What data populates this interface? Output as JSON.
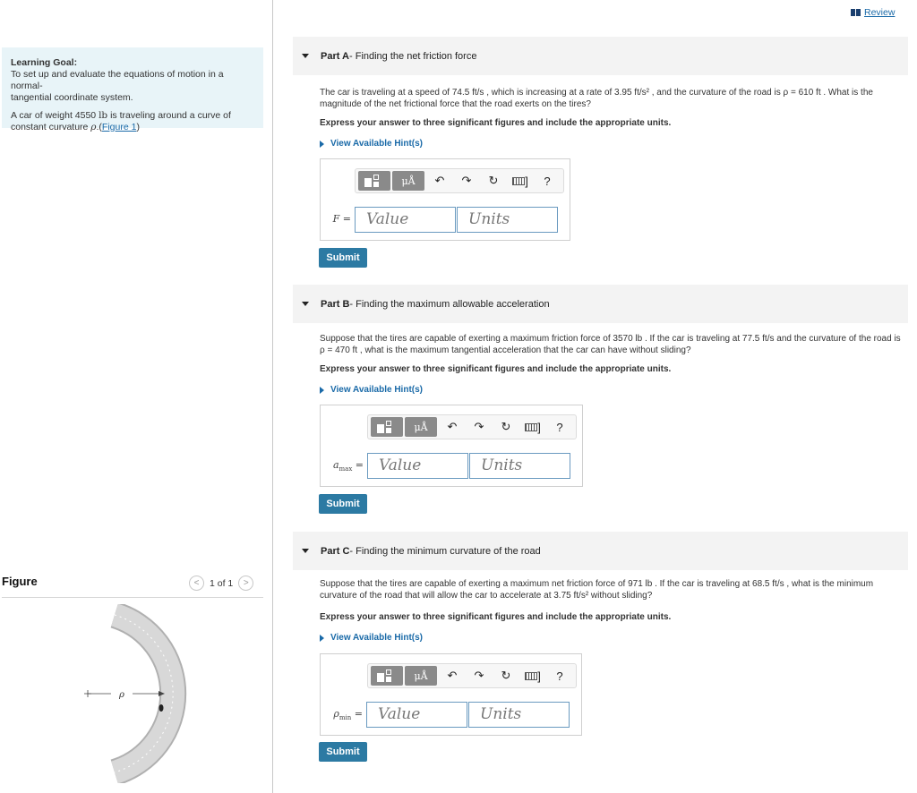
{
  "review": {
    "label": "Review"
  },
  "goal": {
    "title": "Learning Goal:",
    "line1": "To set up and evaluate the equations of motion in a normal-",
    "line2": "tangential coordinate system.",
    "car_pre": "A car of weight 4550 ",
    "car_unit": "lb",
    "car_post": " is traveling around a curve of",
    "car_line2": "constant curvature ",
    "rho": "ρ",
    "period": ".(",
    "figure_link": "Figure 1",
    "close": ")"
  },
  "figure": {
    "title": "Figure",
    "counter": "1 of 1",
    "prev": "<",
    "next": ">",
    "rho_label": "ρ"
  },
  "toolbar": {
    "mu": "μÅ",
    "undo": "↶",
    "redo": "↷",
    "reset": "↻",
    "help": "?",
    "kbd_bracket": "]"
  },
  "parts": [
    {
      "label": "Part A",
      "title": " - Finding the net friction force",
      "text": "The car is traveling at a speed of 74.5 ft/s , which is increasing at a rate of 3.95 ft/s² , and the curvature of the road is ρ = 610 ft . What is the magnitude of the net frictional force that the road exerts on the tires?",
      "instruction": "Express your answer to three significant figures and include the appropriate units.",
      "hint": "View Available Hint(s)",
      "var": "F",
      "var_sub": "",
      "eq": "=",
      "value_placeholder": "Value",
      "units_placeholder": "Units",
      "submit": "Submit"
    },
    {
      "label": "Part B",
      "title": " - Finding the maximum allowable acceleration",
      "text": "Suppose that the tires are capable of exerting a maximum friction force of 3570 lb . If the car is traveling at 77.5 ft/s and the curvature of the road is ρ = 470 ft , what is the maximum tangential acceleration that the car can have without sliding?",
      "instruction": "Express your answer to three significant figures and include the appropriate units.",
      "hint": "View Available Hint(s)",
      "var": "a",
      "var_sub": "max",
      "eq": "=",
      "value_placeholder": "Value",
      "units_placeholder": "Units",
      "submit": "Submit"
    },
    {
      "label": "Part C",
      "title": " - Finding the minimum curvature of the road",
      "text": "Suppose that the tires are capable of exerting a maximum net friction force of 971 lb . If the car is traveling at 68.5 ft/s , what is the minimum curvature of the road that will allow the car to accelerate at 3.75 ft/s² without sliding?",
      "instruction": "Express your answer to three significant figures and include the appropriate units.",
      "hint": "View Available Hint(s)",
      "var": "ρ",
      "var_sub": "min",
      "eq": "=",
      "value_placeholder": "Value",
      "units_placeholder": "Units",
      "submit": "Submit"
    }
  ]
}
